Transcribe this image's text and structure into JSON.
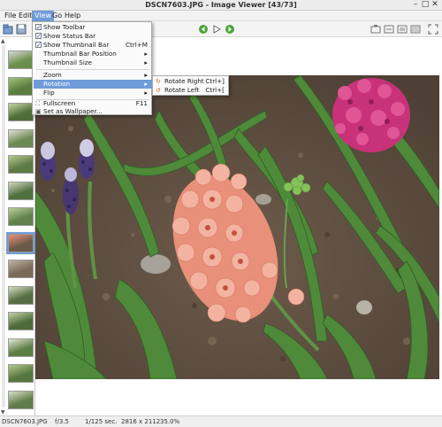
{
  "window": {
    "title": "DSCN7603.JPG - Image Viewer [43/73]",
    "minimize_symbol": "–",
    "maximize_symbol": "□",
    "close_symbol": "✕"
  },
  "menubar": {
    "items": [
      "File",
      "Edit",
      "View",
      "Go",
      "Help"
    ],
    "active": "View"
  },
  "view_menu": {
    "show_toolbar": "Show Toolbar",
    "show_status_bar": "Show Status Bar",
    "show_thumbnail_bar": "Show Thumbnail Bar",
    "show_thumbnail_bar_accel": "Ctrl+M",
    "thumbnail_bar_position": "Thumbnail Bar Position",
    "thumbnail_size": "Thumbnail Size",
    "zoom": "Zoom",
    "rotation": "Rotation",
    "flip": "Flip",
    "fullscreen": "Fullscreen",
    "fullscreen_accel": "F11",
    "set_as_wallpaper": "Set as Wallpaper...",
    "checked": {
      "show_toolbar": true,
      "show_status_bar": true,
      "show_thumbnail_bar": true
    }
  },
  "rotation_submenu": {
    "rotate_right": "Rotate Right",
    "rotate_right_accel": "Ctrl+]",
    "rotate_left": "Rotate Left",
    "rotate_left_accel": "Ctrl+["
  },
  "toolbar": {
    "icons": [
      "open-icon",
      "save-icon",
      "back-icon",
      "play-icon",
      "forward-icon",
      "zoom-in-icon",
      "zoom-out-icon",
      "fit-icon",
      "original-size-icon",
      "fullscreen-icon"
    ]
  },
  "statusbar": {
    "filename": "DSCN7603.JPG",
    "aperture": "f/3.5",
    "exposure": "1/125 sec.",
    "dimensions": "2816 x 2112",
    "zoom": "35.0%"
  },
  "thumbnails": {
    "count": 14,
    "selected_index": 7
  },
  "colors": {
    "accent": "#6f9bd8",
    "menu_bg": "#fafafa",
    "soil": "#6b5a4a",
    "leaf_green": "#4f8a3a",
    "hyacinth_pink": "#e8907a",
    "hyacinth_magenta": "#c8327a",
    "muscari_purple": "#4a3a7a"
  }
}
